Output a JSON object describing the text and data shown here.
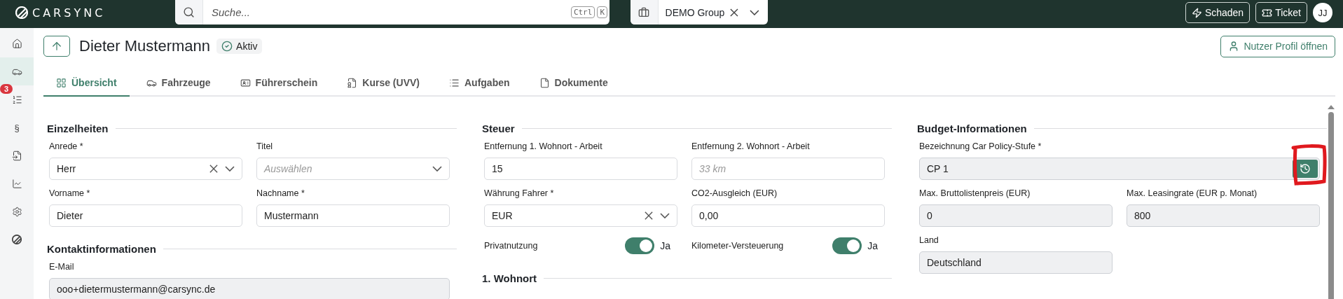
{
  "topbar": {
    "logo": "CARSYNC",
    "search": {
      "placeholder": "Suche...",
      "shortcut": [
        "Ctrl",
        "K"
      ]
    },
    "group": {
      "value": "DEMO Group"
    },
    "buttons": [
      "Schaden",
      "Ticket"
    ],
    "avatar": "JJ"
  },
  "sidebar": {
    "items": [
      {
        "selected": false
      },
      {
        "selected": true
      },
      {
        "selected": false,
        "badge": "3"
      },
      {
        "selected": false,
        "glyph": "§"
      },
      {
        "selected": false
      },
      {
        "selected": false
      },
      {
        "selected": false
      },
      {
        "selected": false
      }
    ]
  },
  "header": {
    "title": "Dieter Mustermann",
    "status": "Aktiv",
    "profile_button": "Nutzer Profil öffnen"
  },
  "tabs": [
    {
      "label": "Übersicht",
      "selected": true
    },
    {
      "label": "Fahrzeuge",
      "selected": false
    },
    {
      "label": "Führerschein",
      "selected": false
    },
    {
      "label": "Kurse (UVV)",
      "selected": false
    },
    {
      "label": "Aufgaben",
      "selected": false
    },
    {
      "label": "Dokumente",
      "selected": false
    }
  ],
  "columns": [
    [
      {
        "title": "Einzelheiten",
        "fields": [
          {
            "kind": "select",
            "label": "Anrede *",
            "value": "Herr",
            "readonly": false
          },
          {
            "kind": "select",
            "label": "Titel",
            "placeholder": "Auswählen",
            "readonly": false
          },
          {
            "kind": "text",
            "label": "Vorname *",
            "value": "Dieter",
            "readonly": false
          },
          {
            "kind": "text",
            "label": "Nachname *",
            "value": "Mustermann",
            "readonly": false
          }
        ]
      },
      {
        "title": "Kontaktinformationen",
        "fields": [
          {
            "kind": "wide",
            "label": "E-Mail",
            "value": "ooo+dietermustermann@carsync.de",
            "readonly": true
          }
        ]
      }
    ],
    [
      {
        "title": "Steuer",
        "fields": [
          {
            "kind": "text",
            "label": "Entfernung 1. Wohnort - Arbeit",
            "value": "15",
            "readonly": false
          },
          {
            "kind": "text",
            "label": "Entfernung 2. Wohnort - Arbeit",
            "placeholder": "33 km",
            "readonly": false
          },
          {
            "kind": "select",
            "label": "Währung Fahrer *",
            "value": "EUR",
            "readonly": false
          },
          {
            "kind": "text",
            "label": "CO2-Ausgleich (EUR)",
            "value": "0,00",
            "readonly": false
          },
          {
            "kind": "toggle",
            "label": "Privatnutzung",
            "on": true,
            "text": "Ja"
          },
          {
            "kind": "toggle",
            "label": "Kilometer-Versteuerung",
            "on": true,
            "text": "Ja"
          }
        ]
      },
      {
        "title": "1. Wohnort"
      }
    ],
    [
      {
        "title": "Budget-Informationen",
        "fields": [
          {
            "kind": "action",
            "label": "Bezeichnung Car Policy-Stufe *",
            "value": "CP 1",
            "readonly": true,
            "highlighted": true
          },
          {
            "kind": "text",
            "label": "Max. Bruttolistenpreis (EUR)",
            "value": "0",
            "readonly": true
          },
          {
            "kind": "text",
            "label": "Max. Leasingrate (EUR p. Monat)",
            "value": "800",
            "readonly": true
          },
          {
            "kind": "text",
            "label": "Land",
            "value": "Deutschland",
            "readonly": true
          }
        ]
      }
    ]
  ]
}
